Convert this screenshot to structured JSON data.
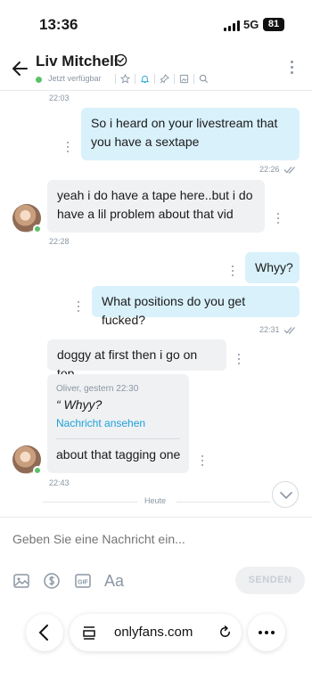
{
  "status_bar": {
    "time": "13:36",
    "network": "5G",
    "battery": "81"
  },
  "header": {
    "contact_name": "Liv Mitchell",
    "presence": "Jetzt verfügbar",
    "icons": [
      "star-icon",
      "bell-icon",
      "pin-icon",
      "image-icon",
      "search-icon"
    ]
  },
  "messages": [
    {
      "time": "22:03"
    },
    {
      "side": "out",
      "text_lines": [
        "So i heard on your livestream that",
        "you have a sextape"
      ],
      "time": "22:26"
    },
    {
      "side": "in",
      "text_lines": [
        "yeah i do have a tape here..but i do",
        "have a lil problem about that vid"
      ],
      "time": "22:28"
    },
    {
      "side": "out",
      "text": "Whyy?"
    },
    {
      "side": "out",
      "text": "What positions do you get fucked?",
      "time": "22:31"
    },
    {
      "side": "in",
      "text": "doggy at first then i go on top"
    },
    {
      "side": "in",
      "reply": {
        "author": "Oliver, gestern 22:30",
        "quote": "“ Whyy?",
        "link": "Nachricht ansehen"
      },
      "text": "about that tagging one",
      "time": "22:43"
    }
  ],
  "divider_label": "Heute",
  "composer": {
    "placeholder": "Geben Sie eine Nachricht ein...",
    "tools": [
      "image-icon",
      "dollar-icon",
      "gif-icon",
      "font-icon"
    ],
    "font_tool_label": "Aa",
    "send_label": "SENDEN"
  },
  "browser": {
    "url": "onlyfans.com"
  },
  "colors": {
    "accent": "#1da1d8",
    "outgoing_bubble": "#d9f1fb",
    "incoming_bubble": "#f0f1f3",
    "online": "#5cc16a"
  }
}
